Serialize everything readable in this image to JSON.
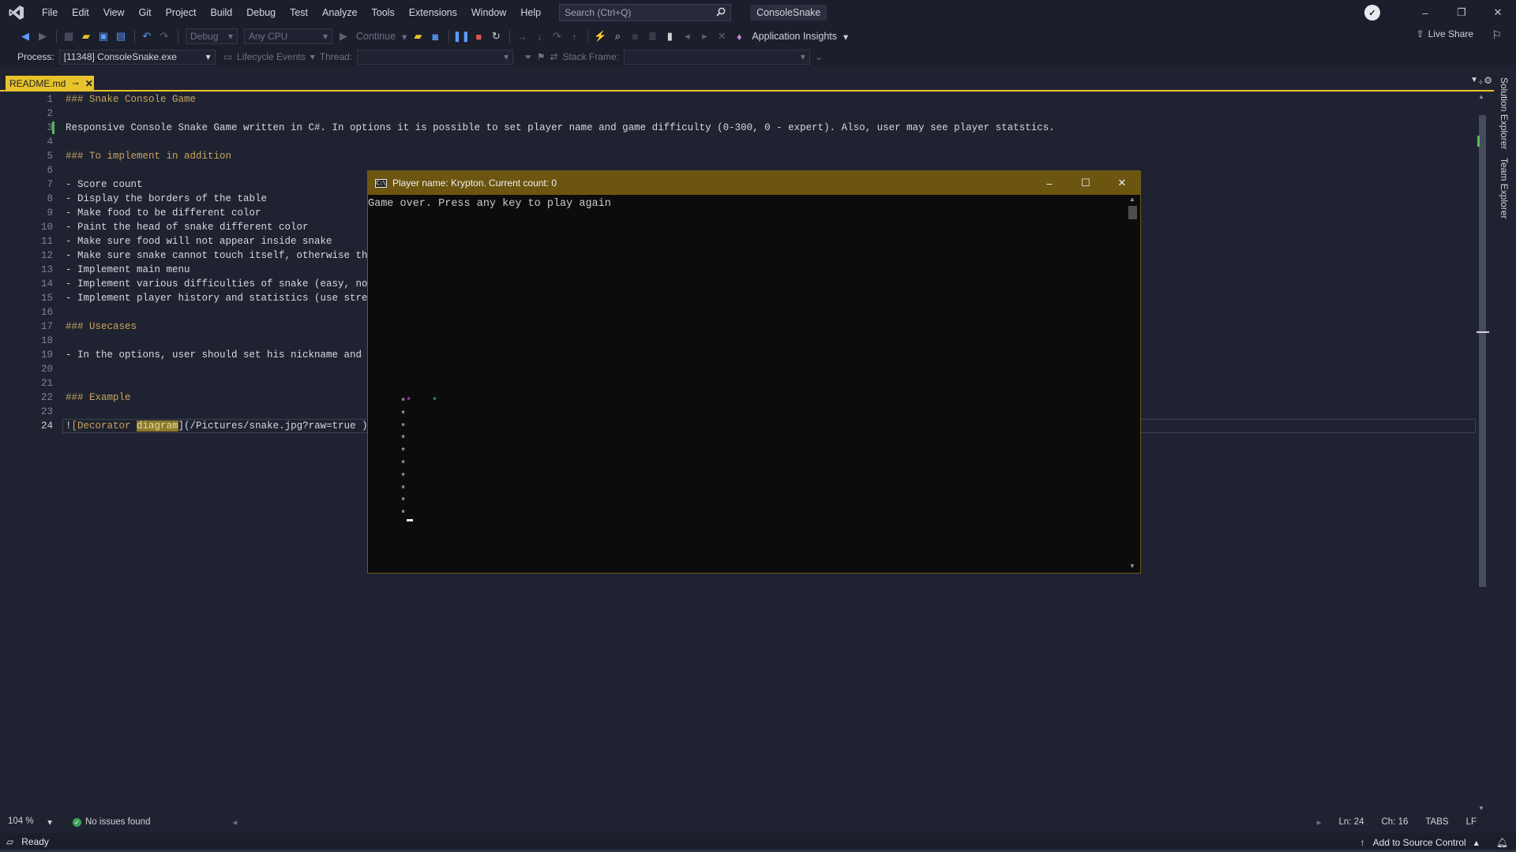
{
  "menubar": {
    "items": [
      "File",
      "Edit",
      "View",
      "Git",
      "Project",
      "Build",
      "Debug",
      "Test",
      "Analyze",
      "Tools",
      "Extensions",
      "Window",
      "Help"
    ],
    "search_placeholder": "Search (Ctrl+Q)",
    "solution_name": "ConsoleSnake"
  },
  "toolbar": {
    "configuration": "Debug",
    "platform": "Any CPU",
    "continue_label": "Continue",
    "app_insights_label": "Application Insights",
    "live_share_label": "Live Share"
  },
  "debugbar": {
    "process_label": "Process:",
    "process_value": "[11348] ConsoleSnake.exe",
    "lifecycle_label": "Lifecycle Events",
    "thread_label": "Thread:",
    "stack_frame_label": "Stack Frame:"
  },
  "tabs": [
    {
      "label": "README.md",
      "active": true
    }
  ],
  "editor": {
    "lines": [
      {
        "n": "1",
        "text": "### Snake Console Game",
        "heading": true
      },
      {
        "n": "2",
        "text": ""
      },
      {
        "n": "3",
        "text": "Responsive Console Snake Game written in C#. In options it is possible to set player name and game difficulty (0-300, 0 - expert). Also, user may see player statstics."
      },
      {
        "n": "4",
        "text": ""
      },
      {
        "n": "5",
        "text": "### To implement in addition",
        "heading": true
      },
      {
        "n": "6",
        "text": ""
      },
      {
        "n": "7",
        "text": "- Score count"
      },
      {
        "n": "8",
        "text": "- Display the borders of the table"
      },
      {
        "n": "9",
        "text": "- Make food to be different color"
      },
      {
        "n": "10",
        "text": "- Paint the head of snake different color"
      },
      {
        "n": "11",
        "text": "- Make sure food will not appear inside snake"
      },
      {
        "n": "12",
        "text": "- Make sure snake cannot touch itself, otherwise thr"
      },
      {
        "n": "13",
        "text": "- Implement main menu"
      },
      {
        "n": "14",
        "text": "- Implement various difficulties of snake (easy, nor"
      },
      {
        "n": "15",
        "text": "- Implement player history and statistics (use strea"
      },
      {
        "n": "16",
        "text": ""
      },
      {
        "n": "17",
        "text": "### Usecases",
        "heading": true
      },
      {
        "n": "18",
        "text": ""
      },
      {
        "n": "19",
        "text": "- In the options, user should set his nickname and d"
      },
      {
        "n": "20",
        "text": ""
      },
      {
        "n": "21",
        "text": ""
      },
      {
        "n": "22",
        "text": "### Example",
        "heading": true
      },
      {
        "n": "23",
        "text": ""
      }
    ],
    "last_line": {
      "n": "24",
      "prefix": "!",
      "link_open": "[Decorator ",
      "highlight": "diagram",
      "rest": "](/Pictures/snake.jpg?raw=true )"
    },
    "current_line": 24,
    "changed_line": 3
  },
  "console": {
    "title": "Player name: Krypton. Current count: 0",
    "message": "Game over. Press any key to play again",
    "snake_glyph": "*",
    "food_glyph": "*",
    "colors": {
      "food": "#36c870",
      "head": "#d050d0",
      "title_bar": "#6b5510"
    }
  },
  "side_tabs": [
    "Solution Explorer",
    "Team Explorer"
  ],
  "editor_footer": {
    "zoom": "104 %",
    "issues": "No issues found",
    "line": "Ln: 24",
    "col": "Ch: 16",
    "tabs": "TABS",
    "eol": "LF"
  },
  "statusbar": {
    "ready": "Ready",
    "source_control": "Add to Source Control"
  },
  "colors": {
    "accent": "#e8c22a",
    "background": "#1f2331",
    "chrome": "#1b1e2b"
  }
}
